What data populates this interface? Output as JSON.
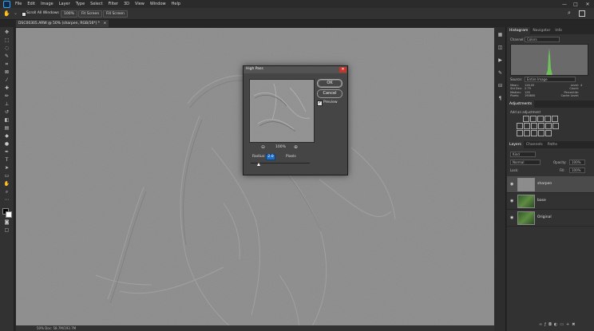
{
  "app": {
    "menu": [
      "File",
      "Edit",
      "Image",
      "Layer",
      "Type",
      "Select",
      "Filter",
      "3D",
      "View",
      "Window",
      "Help"
    ],
    "window_controls": [
      "—",
      "□",
      "✕"
    ]
  },
  "options": {
    "scroll_all": "Scroll All Windows",
    "zoom": "100%",
    "fit_screen": "Fit Screen",
    "fill_screen": "Fill Screen"
  },
  "document": {
    "tab_label": "DSC00305.ARW @ 50% (sharpen, RGB/16*) *",
    "status": "50%     Doc: 58.7M/193.7M"
  },
  "dialog": {
    "title": "High Pass",
    "ok": "OK",
    "cancel": "Cancel",
    "preview_label": "Preview",
    "zoom_level": "100%",
    "radius_label": "Radius:",
    "radius_value": "2.0",
    "radius_unit": "Pixels"
  },
  "histogram": {
    "tabs": [
      "Histogram",
      "Navigator",
      "Info"
    ],
    "channel_label": "Channel:",
    "channel_value": "Colors",
    "source_label": "Source:",
    "source_value": "Entire Image",
    "stats_left": [
      "Mean:",
      "Std Dev:",
      "Median:",
      "Pixels:"
    ],
    "stats_left_vals": [
      "126.05",
      "2.79",
      "126",
      "190800"
    ],
    "stats_right": [
      "Level:",
      "Count:",
      "Percentile:",
      "Cache Level:"
    ],
    "stats_right_vals": [
      "",
      "",
      "",
      "4"
    ]
  },
  "adjustments": {
    "tab": "Adjustments",
    "hint": "Add an adjustment"
  },
  "layers": {
    "tabs": [
      "Layers",
      "Channels",
      "Paths"
    ],
    "kind": "Kind",
    "blend": "Normal",
    "opacity_label": "Opacity:",
    "opacity_value": "100%",
    "lock_label": "Lock:",
    "fill_label": "Fill:",
    "fill_value": "100%",
    "items": [
      {
        "name": "sharpen"
      },
      {
        "name": "base"
      },
      {
        "name": "Original"
      }
    ]
  },
  "colors": {
    "accent": "#31a8ff",
    "canvas": "#8c8c8c",
    "close": "#c6352c",
    "histogram": "#6fbf5a"
  }
}
